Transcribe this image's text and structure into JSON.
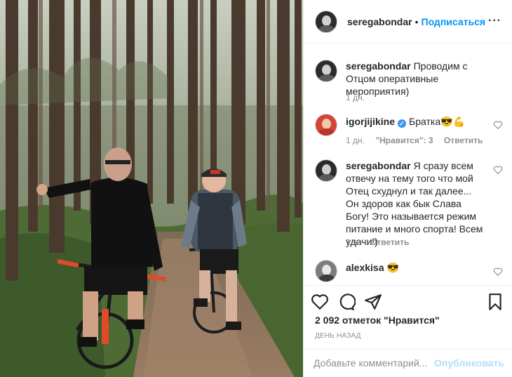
{
  "post": {
    "author": "seregabondar",
    "separator": "•",
    "follow_label": "Подписаться",
    "more_icon": "more-horizontal-icon",
    "photo_description_icon": "photo-cyclists-forest"
  },
  "comments": [
    {
      "username": "seregabondar",
      "text": "Проводим с Отцом оперативные мероприятия)",
      "time": "1 дн."
    },
    {
      "username": "igorjijikine",
      "verified": true,
      "text": "Братка😎💪",
      "time": "1 дн.",
      "likes": "\"Нравится\": 3",
      "reply": "Ответить"
    },
    {
      "username": "seregabondar",
      "text": "Я сразу всем отвечу на тему того что мой Отец схуднул и так далее... Он здоров как бык Слава Богу! Это называется режим питание и много спорта! Всем удачи!)",
      "time": "1 ч.",
      "reply": "Ответить"
    },
    {
      "username": "alexkisa",
      "text": "😎"
    }
  ],
  "actions": {
    "like_icon": "heart-icon",
    "comment_icon": "comment-icon",
    "share_icon": "share-icon",
    "save_icon": "bookmark-icon",
    "likes_text": "2 092 отметок \"Нравится\"",
    "date": "ДЕНЬ НАЗАД"
  },
  "add_comment": {
    "placeholder": "Добавьте комментарий...",
    "publish_label": "Опубликовать"
  },
  "colors": {
    "accent": "#0095f6",
    "publish_disabled": "#b2dffc",
    "muted": "#8e8e8e"
  }
}
